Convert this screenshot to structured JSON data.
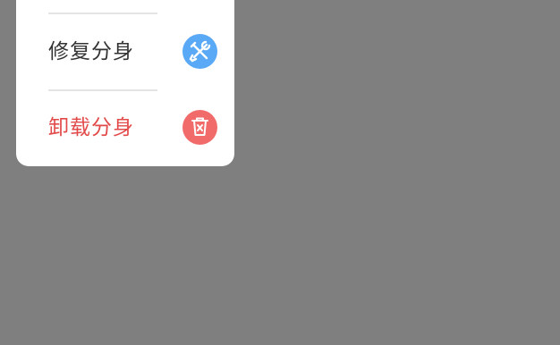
{
  "colors": {
    "overlay": "#7f7f7f",
    "card": "#ffffff",
    "repair_icon_bg": "#5aa9f6",
    "uninstall_icon_bg": "#f26b6b",
    "uninstall_text": "#e24a4a"
  },
  "menu": {
    "items": [
      {
        "label": "修复分身",
        "icon": "tools-icon"
      },
      {
        "label": "卸载分身",
        "icon": "trash-icon"
      }
    ]
  }
}
